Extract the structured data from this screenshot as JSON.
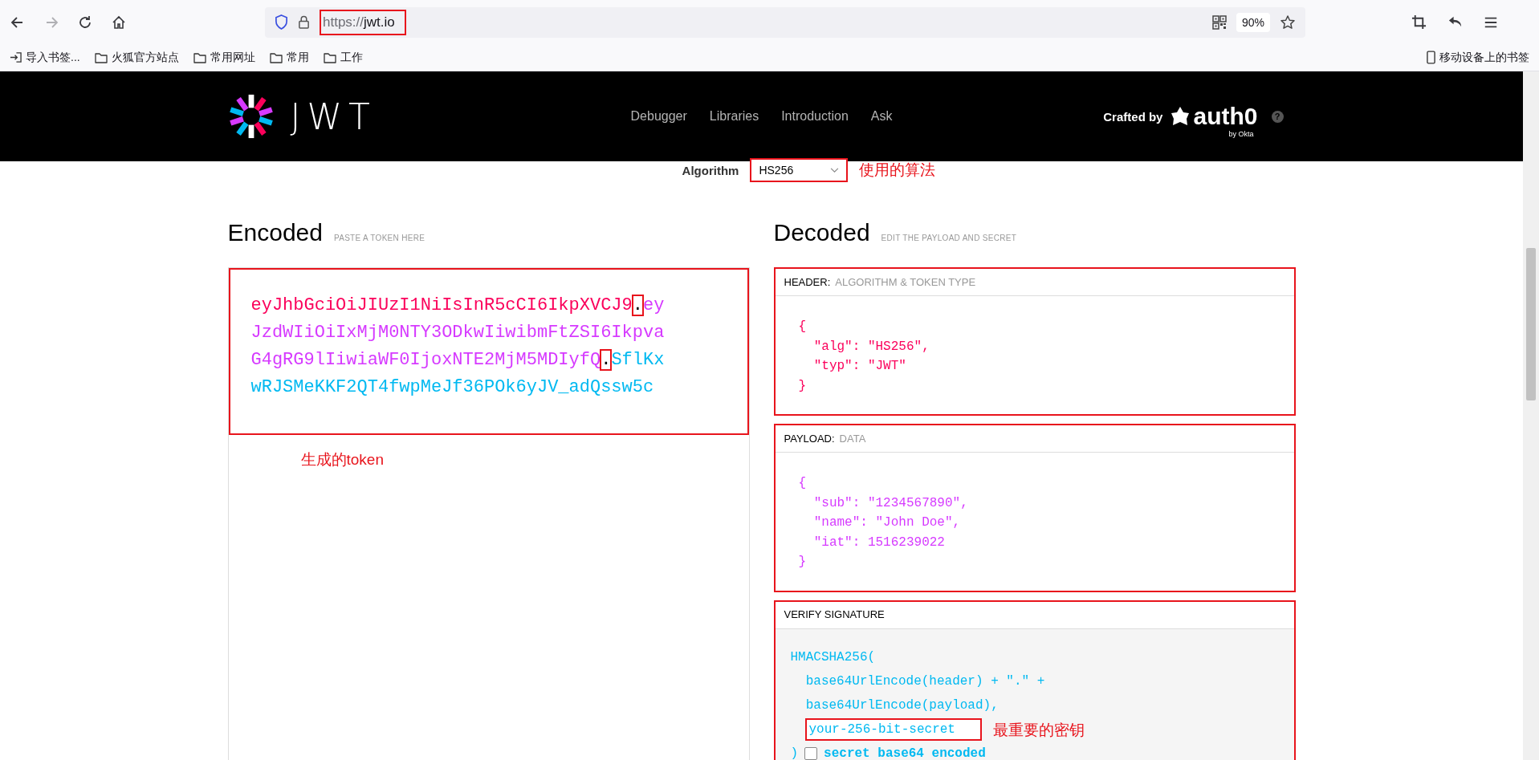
{
  "browser": {
    "nav_buttons": [
      {
        "kind": "back",
        "disabled": false
      },
      {
        "kind": "forward",
        "disabled": true
      },
      {
        "kind": "reload",
        "disabled": false
      },
      {
        "kind": "home",
        "disabled": false
      }
    ],
    "address": {
      "scheme": "https://",
      "host": "jwt.io",
      "annotated": true
    },
    "zoom": "90%",
    "bookmarks": [
      {
        "kind": "import",
        "label": "导入书签..."
      },
      {
        "kind": "folder",
        "label": "火狐官方站点"
      },
      {
        "kind": "folder",
        "label": "常用网址"
      },
      {
        "kind": "folder",
        "label": "常用"
      },
      {
        "kind": "folder",
        "label": "工作"
      }
    ],
    "mobile_bookmarks": "移动设备上的书签"
  },
  "site_header": {
    "logo_text": "JWT",
    "nav": [
      {
        "label": "Debugger"
      },
      {
        "label": "Libraries"
      },
      {
        "label": "Introduction"
      },
      {
        "label": "Ask"
      }
    ],
    "credit": "Crafted by",
    "brand": "auth0",
    "brand_sub": "by Okta",
    "help": "?"
  },
  "algorithm": {
    "label": "Algorithm",
    "value": "HS256",
    "annotated": true,
    "note": "使用的算法"
  },
  "encoded": {
    "title": "Encoded",
    "hint": "PASTE A TOKEN HERE",
    "annotated": true,
    "note": "生成的token",
    "token": [
      {
        "kind": "segment",
        "text": "eyJhbGciOiJIUzI1NiIsInR5cCI6IkpXVCJ9",
        "color": "#fb015b"
      },
      {
        "kind": "dot",
        "text": ".",
        "annotated": true
      },
      {
        "kind": "segment",
        "text": "eyJzdWIiOiIxMjM0NTY3ODkwIiwibmFtZSI6IkpvaG4gRG9lIiwiaWF0IjoxNTE2MjM5MDIyfQ",
        "color": "#d63aff"
      },
      {
        "kind": "dot",
        "text": ".",
        "annotated": true
      },
      {
        "kind": "segment",
        "text": "SflKxwRJSMeKKF2QT4fwpMeJf36POk6yJV_adQssw5c",
        "color": "#00b9f1"
      }
    ]
  },
  "decoded": {
    "title": "Decoded",
    "hint": "EDIT THE PAYLOAD AND SECRET",
    "panels": [
      {
        "kind": "code",
        "title": "HEADER:",
        "subtitle": "ALGORITHM & TOKEN TYPE",
        "color": "#fb015b",
        "annotated": true,
        "lines": [
          "{",
          "  \"alg\": \"HS256\",",
          "  \"typ\": \"JWT\"",
          "}"
        ]
      },
      {
        "kind": "code",
        "title": "PAYLOAD:",
        "subtitle": "DATA",
        "color": "#d63aff",
        "annotated": true,
        "lines": [
          "{",
          "  \"sub\": \"1234567890\",",
          "  \"name\": \"John Doe\",",
          "  \"iat\": 1516239022",
          "}"
        ]
      },
      {
        "kind": "signature",
        "title": "VERIFY SIGNATURE",
        "color": "#00b9f1",
        "annotated": true,
        "lines": [
          "HMACSHA256(",
          "  base64UrlEncode(header) + \".\" +",
          "  base64UrlEncode(payload),"
        ],
        "secret": {
          "value": "your-256-bit-secret",
          "annotated": true,
          "note": "最重要的密钥"
        },
        "close": ")",
        "checkbox": {
          "label": "secret base64 encoded",
          "checked": false
        }
      }
    ]
  }
}
